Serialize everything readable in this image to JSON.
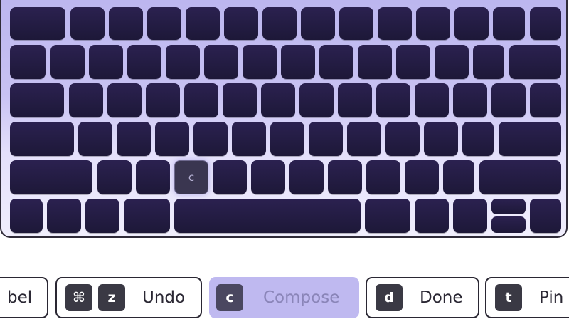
{
  "keyboard": {
    "highlighted_key": "c"
  },
  "shortcuts": [
    {
      "keys": [],
      "label": "bel"
    },
    {
      "keys": [
        "⌘",
        "z"
      ],
      "label": "Undo"
    },
    {
      "keys": [
        "c"
      ],
      "label": "Compose",
      "active": true
    },
    {
      "keys": [
        "d"
      ],
      "label": "Done"
    },
    {
      "keys": [
        "t"
      ],
      "label": "Pin"
    }
  ],
  "colors": {
    "key": "#1d1838",
    "keyboard_bg": "#c8c2f3",
    "active_chip": "#bfb9f0"
  }
}
